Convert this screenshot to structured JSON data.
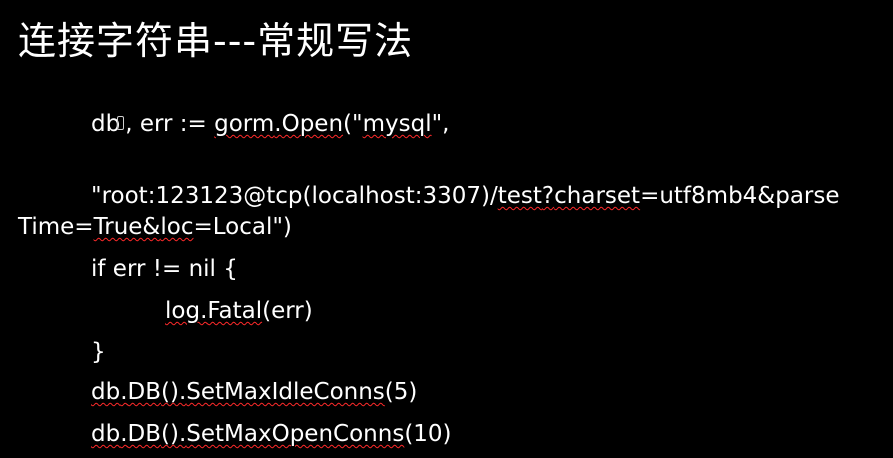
{
  "slide": {
    "title": "连接字符串---常规写法",
    "code": {
      "line1": {
        "prefix": "db",
        "rest": ", err := ",
        "gorm": "gorm",
        "dot": ".",
        "open": "Open",
        "paren_q": "(\"",
        "mysql": "mysql",
        "tail": "\","
      },
      "line2": {
        "part1": "\"root:123123@tcp(localhost:3307)/",
        "test": "test",
        "q": "?",
        "charset": "charset",
        "part2": "=utf8mb4&parse"
      },
      "line3": {
        "part1": "Time=",
        "true": "True",
        "amp": "&",
        "loc": "loc",
        "part2": "=Local\")"
      },
      "line4": "if err != nil {",
      "line5": {
        "log": "log",
        "dot": ".",
        "fatal": "Fatal",
        "rest": "(err)"
      },
      "line6": "}",
      "line7": {
        "db": "db",
        "dot1": ".",
        "dbfn": "DB",
        "mid": "().",
        "method": "SetMaxIdleConns",
        "args": "(5)"
      },
      "line8": {
        "db": "db",
        "dot1": ".",
        "dbfn": "DB",
        "mid": "().",
        "method": "SetMaxOpenConns",
        "args": "(10)"
      }
    },
    "colors": {
      "background": "#000000",
      "text": "#ffffff",
      "spellcheck_underline": "#ff2a2a"
    }
  }
}
